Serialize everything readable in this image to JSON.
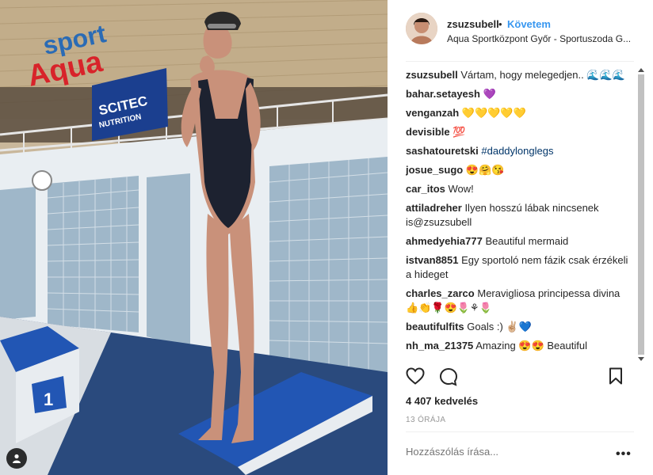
{
  "post": {
    "username": "zsuzsubell",
    "separator": "•",
    "follow_label": "Követem",
    "location": "Aqua Sportközpont Győr - Sportuszoda G...",
    "likes": "4 407 kedvelés",
    "time": "13 órája",
    "comment_placeholder": "Hozzászólás írása...",
    "more_label": "•••"
  },
  "photo": {
    "signs": [
      "sport",
      "Aqua",
      "SCITEC",
      "NUTRITION"
    ],
    "lane_number": "1"
  },
  "comments": [
    {
      "user": "zsuzsubell",
      "text": "Vártam, hogy melegedjen.. 🌊🌊🌊"
    },
    {
      "user": "bahar.setayesh",
      "text": "💜"
    },
    {
      "user": "venganzah",
      "text": "💛💛💛💛💛"
    },
    {
      "user": "devisible",
      "text": "💯"
    },
    {
      "user": "sashatouretski",
      "text": "#daddylonglegs"
    },
    {
      "user": "josue_sugo",
      "text": "😍🤗😘"
    },
    {
      "user": "car_itos",
      "text": "Wow!"
    },
    {
      "user": "attiladreher",
      "text": "Ilyen hosszú lábak nincsenek is@zsuzsubell"
    },
    {
      "user": "ahmedyehia777",
      "text": "Beautiful mermaid"
    },
    {
      "user": "istvan8851",
      "text": "Egy sportoló nem fázik csak érzékeli a hideget"
    },
    {
      "user": "charles_zarco",
      "text": "Meravigliosa principessa divina👍👏🌹😍🌷⚘🌷"
    },
    {
      "user": "beautifulfits",
      "text": "Goals :) ✌🏼💙"
    },
    {
      "user": "nh_ma_21375",
      "text": "Amazing 😍😍 Beautiful"
    }
  ],
  "colors": {
    "link": "#3897f0",
    "hashtag": "#003569",
    "muted": "#999999"
  }
}
